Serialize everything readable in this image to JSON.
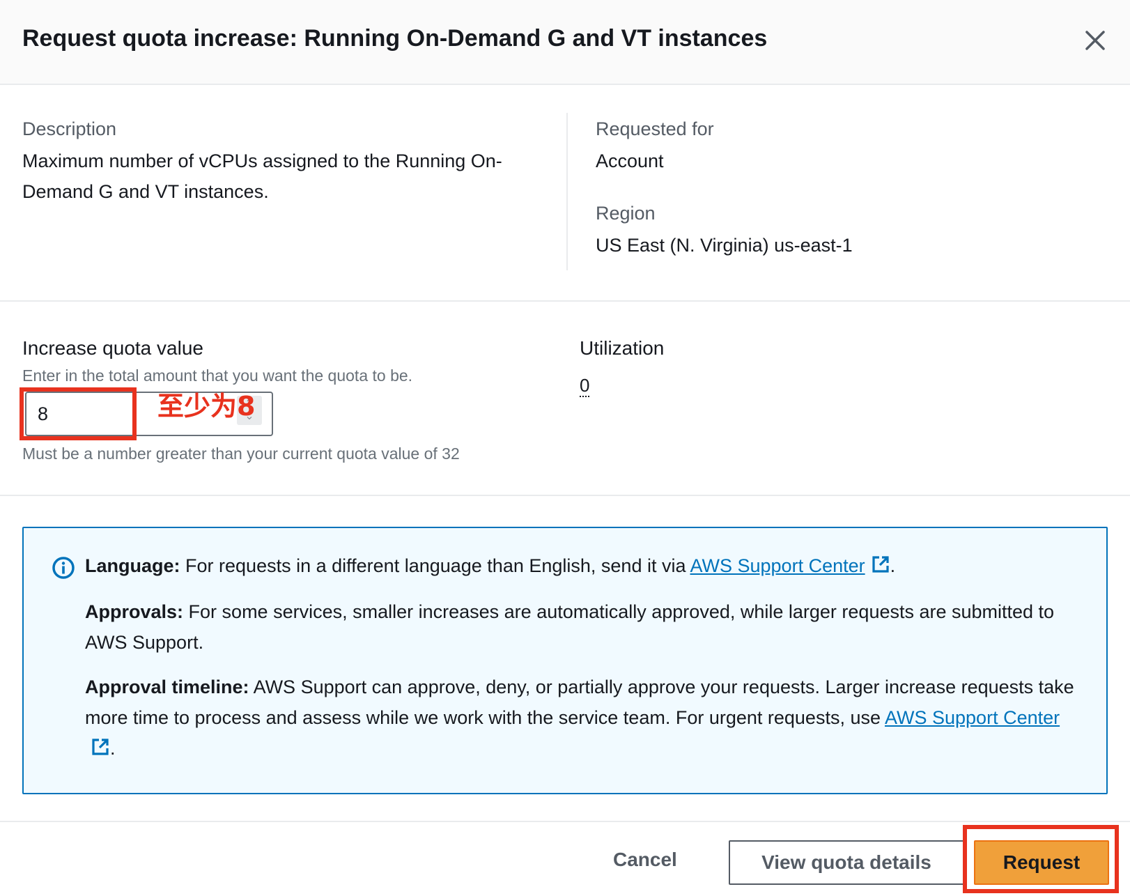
{
  "modal": {
    "title": "Request quota increase: Running On-Demand G and VT instances",
    "close_icon": "close-icon"
  },
  "details": {
    "description_label": "Description",
    "description_value": "Maximum number of vCPUs assigned to the Running On-Demand G and VT instances.",
    "requested_for_label": "Requested for",
    "requested_for_value": "Account",
    "region_label": "Region",
    "region_value": "US East (N. Virginia) us-east-1"
  },
  "quota": {
    "label": "Increase quota value",
    "help": "Enter in the total amount that you want the quota to be.",
    "value": "8",
    "constraint": "Must be a number greater than your current quota value of 32",
    "annotation": "至少为8"
  },
  "utilization": {
    "label": "Utilization",
    "value": "0"
  },
  "info": {
    "icon": "info-icon",
    "language_title": "Language:",
    "language_text": "For requests in a different language than English, send it via",
    "language_link": "AWS Support Center",
    "approvals_title": "Approvals:",
    "approvals_text": "For some services, smaller increases are automatically approved, while larger requests are submitted to AWS Support.",
    "timeline_title": "Approval timeline:",
    "timeline_text": "AWS Support can approve, deny, or partially approve your requests. Larger increase requests take more time to process and assess while we work with the service team. For urgent requests, use",
    "timeline_link": "AWS Support Center",
    "period": "."
  },
  "footer": {
    "cancel": "Cancel",
    "view_details": "View quota details",
    "request": "Request"
  },
  "colors": {
    "annotation": "#e8321e",
    "primary_button": "#f0a03a",
    "link": "#0073bb",
    "info_background": "#f1faff"
  }
}
